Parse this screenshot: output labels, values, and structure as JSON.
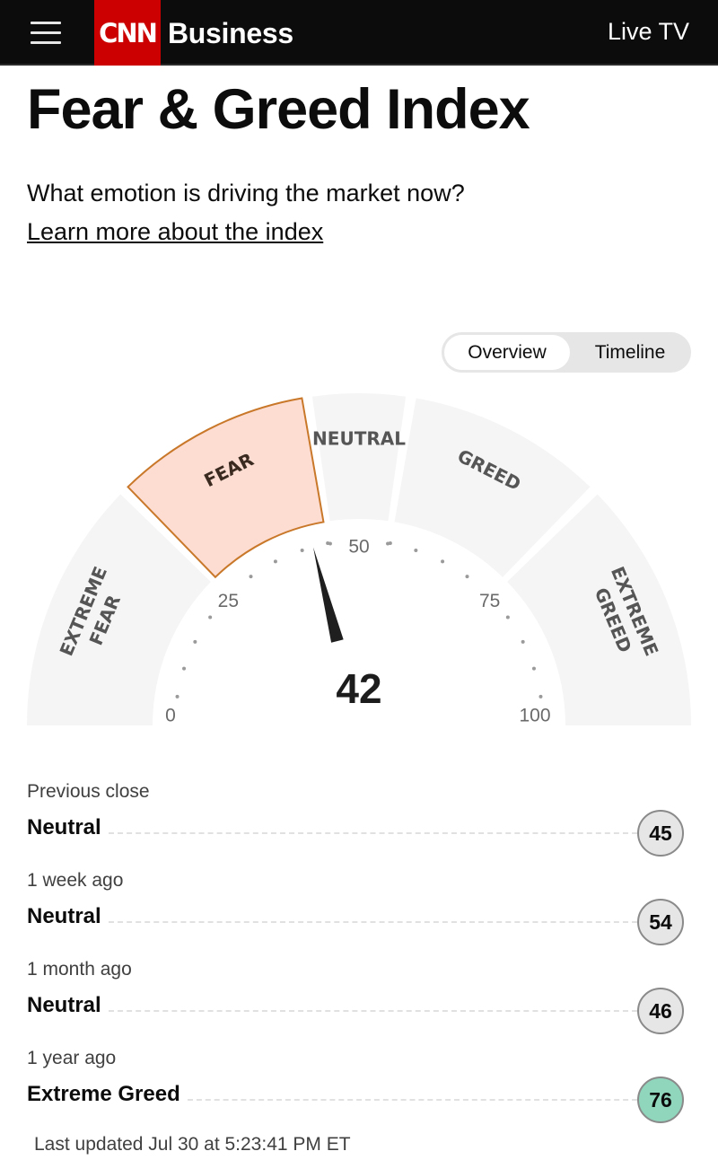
{
  "header": {
    "menu_icon": "hamburger-menu-icon",
    "logo_text": "CNN",
    "section": "Business",
    "live_tv": "Live TV",
    "colors": {
      "bar": "#0c0c0c",
      "logo": "#cc0000"
    }
  },
  "page": {
    "title": "Fear & Greed Index",
    "subtitle": "What emotion is driving the market now?",
    "learn_link": "Learn more about the index"
  },
  "view_toggle": {
    "options": [
      "Overview",
      "Timeline"
    ],
    "selected": "Overview"
  },
  "gauge": {
    "value": 42,
    "min": 0,
    "max": 100,
    "active_zone": "FEAR",
    "zones": [
      {
        "id": "extreme-fear",
        "lines": [
          "EXTREME",
          "FEAR"
        ],
        "from": 0,
        "to": 25
      },
      {
        "id": "fear",
        "lines": [
          "FEAR"
        ],
        "from": 25,
        "to": 45
      },
      {
        "id": "neutral",
        "lines": [
          "NEUTRAL"
        ],
        "from": 45,
        "to": 55
      },
      {
        "id": "greed",
        "lines": [
          "GREED"
        ],
        "from": 55,
        "to": 75
      },
      {
        "id": "extreme-greed",
        "lines": [
          "EXTREME",
          "GREED"
        ],
        "from": 75,
        "to": 100
      }
    ],
    "tick_labels": [
      "0",
      "25",
      "50",
      "75",
      "100"
    ],
    "tick_values": [
      0,
      25,
      50,
      75,
      100
    ],
    "colors": {
      "zone": "#f5f5f5",
      "active_fill": "#fdddd2",
      "active_stroke": "#c9782a",
      "needle": "#1f1f1f",
      "text": "#555555"
    }
  },
  "history": [
    {
      "label": "Previous close",
      "rating": "Neutral",
      "score": "45",
      "color": "#e6e6e6"
    },
    {
      "label": "1 week ago",
      "rating": "Neutral",
      "score": "54",
      "color": "#e6e6e6"
    },
    {
      "label": "1 month ago",
      "rating": "Neutral",
      "score": "46",
      "color": "#e6e6e6"
    },
    {
      "label": "1 year ago",
      "rating": "Extreme Greed",
      "score": "76",
      "color": "#8fd6bd"
    }
  ],
  "last_updated": "Last updated Jul 30 at 5:23:41 PM ET"
}
